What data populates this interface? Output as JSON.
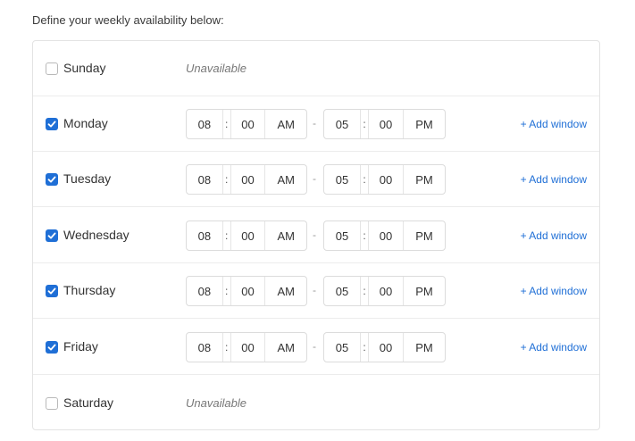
{
  "intro": "Define your weekly availability below:",
  "accent_color": "#1f6fd6",
  "days": [
    {
      "name": "Sunday",
      "checked": false,
      "unavailable_text": "Unavailable"
    },
    {
      "name": "Monday",
      "checked": true,
      "start": {
        "hh": "08",
        "mm": "00",
        "ampm": "AM"
      },
      "end": {
        "hh": "05",
        "mm": "00",
        "ampm": "PM"
      },
      "add_window": "+ Add window"
    },
    {
      "name": "Tuesday",
      "checked": true,
      "start": {
        "hh": "08",
        "mm": "00",
        "ampm": "AM"
      },
      "end": {
        "hh": "05",
        "mm": "00",
        "ampm": "PM"
      },
      "add_window": "+ Add window"
    },
    {
      "name": "Wednesday",
      "checked": true,
      "start": {
        "hh": "08",
        "mm": "00",
        "ampm": "AM"
      },
      "end": {
        "hh": "05",
        "mm": "00",
        "ampm": "PM"
      },
      "add_window": "+ Add window"
    },
    {
      "name": "Thursday",
      "checked": true,
      "start": {
        "hh": "08",
        "mm": "00",
        "ampm": "AM"
      },
      "end": {
        "hh": "05",
        "mm": "00",
        "ampm": "PM"
      },
      "add_window": "+ Add window"
    },
    {
      "name": "Friday",
      "checked": true,
      "start": {
        "hh": "08",
        "mm": "00",
        "ampm": "AM"
      },
      "end": {
        "hh": "05",
        "mm": "00",
        "ampm": "PM"
      },
      "add_window": "+ Add window"
    },
    {
      "name": "Saturday",
      "checked": false,
      "unavailable_text": "Unavailable"
    }
  ],
  "separators": {
    "colon": ":",
    "dash": "-"
  }
}
